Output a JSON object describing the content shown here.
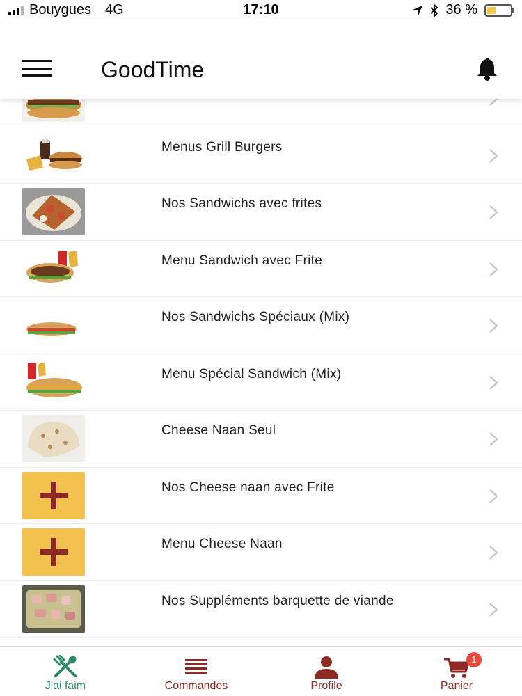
{
  "status_bar": {
    "carrier": "Bouygues",
    "network": "4G",
    "time": "17:10",
    "battery_percent": "36 %",
    "battery_level": 0.36
  },
  "header": {
    "title": "GoodTime"
  },
  "menu_items": [
    {
      "label": "",
      "thumb": "burger-photo"
    },
    {
      "label": "Menus Grill Burgers",
      "thumb": "burger-menu-photo"
    },
    {
      "label": "Nos Sandwichs avec frites",
      "thumb": "sandwich-fries-photo"
    },
    {
      "label": "Menu Sandwich avec Frite",
      "thumb": "sandwich-menu-photo"
    },
    {
      "label": "Nos Sandwichs Spéciaux (Mix)",
      "thumb": "special-sandwich-photo"
    },
    {
      "label": "Menu Spécial Sandwich (Mix)",
      "thumb": "special-sandwich-menu-photo"
    },
    {
      "label": "Cheese Naan Seul",
      "thumb": "cheese-naan-photo"
    },
    {
      "label": "Nos Cheese naan avec Frite",
      "thumb": "plus-placeholder"
    },
    {
      "label": "Menu Cheese Naan",
      "thumb": "plus-placeholder"
    },
    {
      "label": "Nos Suppléments barquette de viande",
      "thumb": "meat-tray-photo"
    }
  ],
  "tab_bar": {
    "tabs": [
      {
        "label": "J'ai faim",
        "icon": "fork-spoon-icon",
        "active": true
      },
      {
        "label": "Commandes",
        "icon": "list-icon",
        "active": false
      },
      {
        "label": "Profile",
        "icon": "user-icon",
        "active": false
      },
      {
        "label": "Panier",
        "icon": "cart-icon",
        "active": false,
        "badge": "1"
      }
    ]
  },
  "colors": {
    "accent": "#8e2a24",
    "active_tab": "#2e8a6a",
    "placeholder_bg": "#f2c14e",
    "badge": "#e34b3e"
  }
}
